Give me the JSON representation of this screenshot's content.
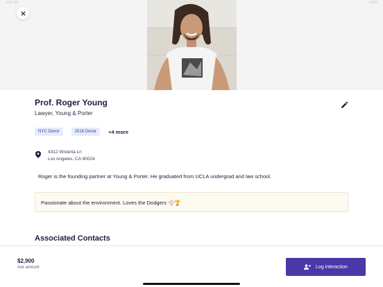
{
  "status_bar": {
    "time": "9:41 AM",
    "battery": "100%"
  },
  "profile": {
    "name": "Prof. Roger Young",
    "subtitle": "Lawyer, Young & Porter",
    "tags": [
      "NYC Donor",
      "2018 Donor"
    ],
    "more_tags": "+4 more",
    "address": {
      "line1": "4312 Wisteria Ln",
      "line2": "Los Angeles, CA 90024"
    },
    "bio": "Roger is the founding partner at Young & Porter. He graduated from UCLA undergrad and law school.",
    "note": "Passionate about the environment. Loves the Dodgers ⚾🏆"
  },
  "sections": {
    "associated_contacts": "Associated Contacts"
  },
  "footer": {
    "amount": "$2,900",
    "amount_label": "Ask amount",
    "log_button": "Log interaction"
  },
  "colors": {
    "accent": "#4b37a8",
    "tag_bg": "#e6ecfb",
    "tag_text": "#2d3ea8",
    "note_bg": "#fdfaf2"
  },
  "icons": {
    "close": "close-icon",
    "edit": "pencil-icon",
    "location": "map-pin-icon",
    "log": "add-person-icon"
  }
}
